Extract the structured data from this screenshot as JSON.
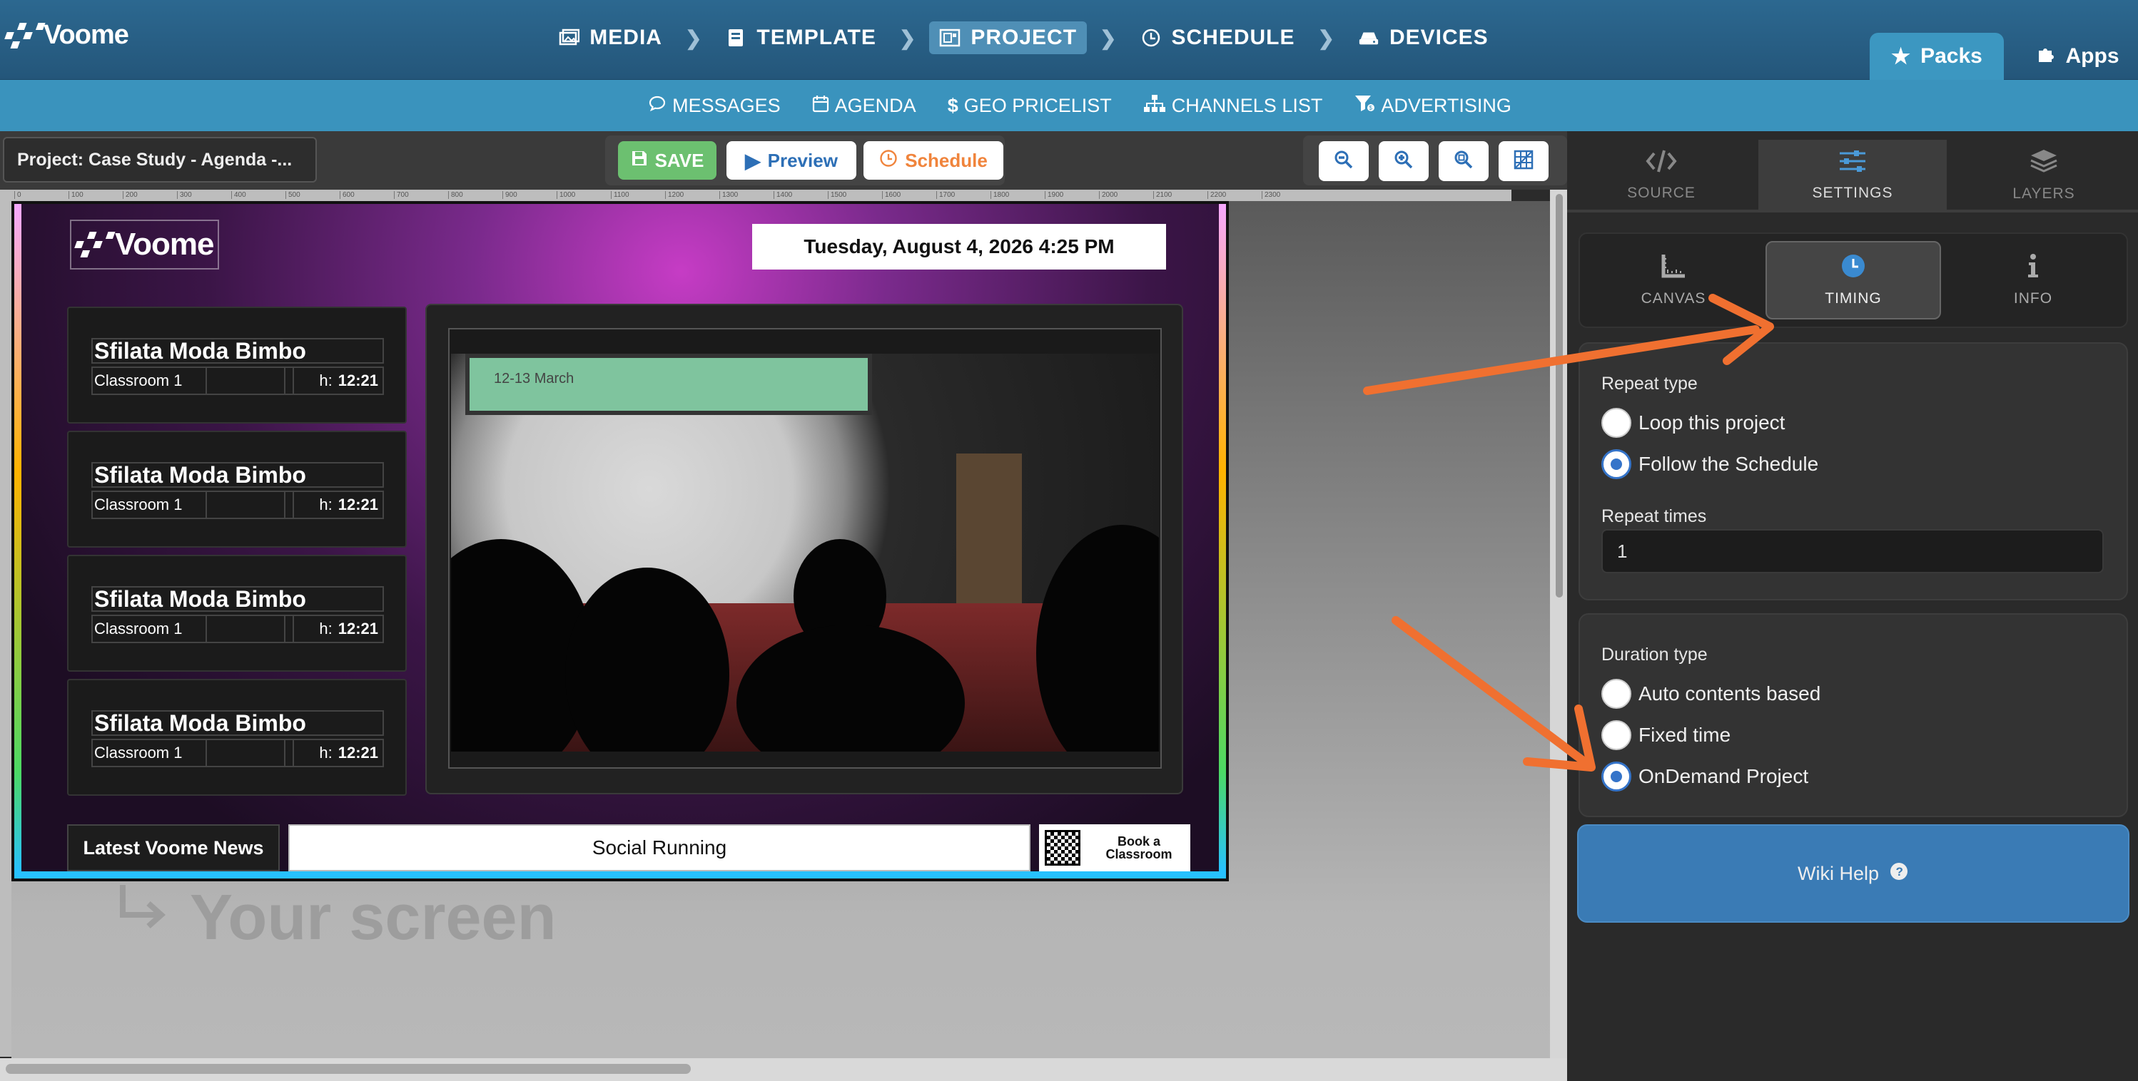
{
  "app": {
    "logo_text": "Voome"
  },
  "nav": {
    "items": [
      {
        "label": "MEDIA",
        "icon": "image-icon",
        "active": false
      },
      {
        "label": "TEMPLATE",
        "icon": "book-icon",
        "active": false
      },
      {
        "label": "PROJECT",
        "icon": "project-icon",
        "active": true
      },
      {
        "label": "SCHEDULE",
        "icon": "clock-icon",
        "active": false
      },
      {
        "label": "DEVICES",
        "icon": "device-icon",
        "active": false
      }
    ],
    "packs_label": "Packs",
    "apps_label": "Apps"
  },
  "subnav": {
    "items": [
      {
        "label": "MESSAGES",
        "icon": "chat-icon"
      },
      {
        "label": "AGENDA",
        "icon": "calendar-icon"
      },
      {
        "label": "GEO PRICELIST",
        "icon": "dollar-icon"
      },
      {
        "label": "CHANNELS LIST",
        "icon": "sitemap-icon"
      },
      {
        "label": "ADVERTISING",
        "icon": "funnel-icon"
      }
    ]
  },
  "toolbar": {
    "project_title": "Project: Case Study - Agenda -...",
    "save_label": "SAVE",
    "preview_label": "Preview",
    "schedule_label": "Schedule"
  },
  "ruler": {
    "ticks": [
      "0",
      "100",
      "200",
      "300",
      "400",
      "500",
      "600",
      "700",
      "800",
      "900",
      "1000",
      "1100",
      "1200",
      "1300",
      "1400",
      "1500",
      "1600",
      "1700",
      "1800",
      "1900",
      "2000",
      "2100",
      "2200",
      "2300"
    ]
  },
  "screen": {
    "logo_text": "Voome",
    "date_text": "Tuesday, August 4, 2026 4:25 PM",
    "cards": [
      {
        "title": "Sfilata Moda Bimbo",
        "room": "Classroom 1",
        "h_label": "h:",
        "time": "12:21"
      },
      {
        "title": "Sfilata Moda Bimbo",
        "room": "Classroom 1",
        "h_label": "h:",
        "time": "12:21"
      },
      {
        "title": "Sfilata Moda Bimbo",
        "room": "Classroom 1",
        "h_label": "h:",
        "time": "12:21"
      },
      {
        "title": "Sfilata Moda Bimbo",
        "room": "Classroom 1",
        "h_label": "h:",
        "time": "12:21"
      }
    ],
    "video_caption": "12-13 March",
    "news_label": "Latest Voome News",
    "ticker_text": "Social Running",
    "book_label_1": "Book a",
    "book_label_2": "Classroom"
  },
  "canvas": {
    "your_screen": "Your screen"
  },
  "panel": {
    "tabs": [
      {
        "label": "SOURCE",
        "icon": "code-icon",
        "active": false
      },
      {
        "label": "SETTINGS",
        "icon": "sliders-icon",
        "active": true
      },
      {
        "label": "LAYERS",
        "icon": "layers-icon",
        "active": false
      }
    ],
    "subtabs": [
      {
        "label": "CANVAS",
        "icon": "ruler-icon",
        "active": false
      },
      {
        "label": "TIMING",
        "icon": "clock-icon",
        "active": true
      },
      {
        "label": "INFO",
        "icon": "info-icon",
        "active": false
      }
    ],
    "repeat_type_label": "Repeat type",
    "repeat_options": [
      {
        "label": "Loop this project",
        "checked": false
      },
      {
        "label": "Follow the Schedule",
        "checked": true
      }
    ],
    "repeat_times_label": "Repeat times",
    "repeat_times_value": "1",
    "duration_type_label": "Duration type",
    "duration_options": [
      {
        "label": "Auto contents based",
        "checked": false
      },
      {
        "label": "Fixed time",
        "checked": false
      },
      {
        "label": "OnDemand Project",
        "checked": true
      }
    ],
    "wiki_label": "Wiki Help"
  },
  "colors": {
    "accent": "#3a93bd",
    "topbar": "#2c6890",
    "save": "#5cb85c",
    "schedule": "#f0843c",
    "arrow": "#f07030",
    "radio_on": "#3574c9"
  }
}
